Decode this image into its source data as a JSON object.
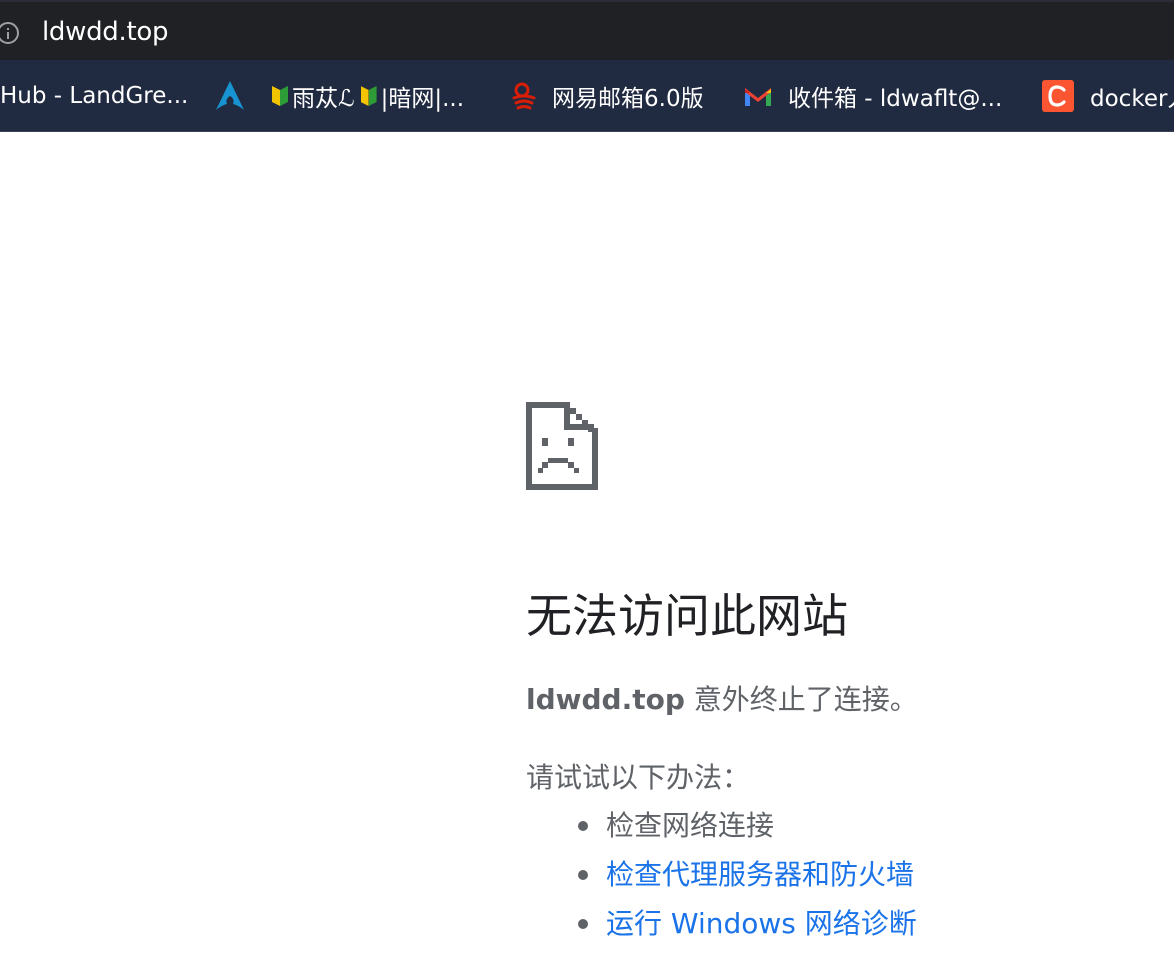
{
  "address_bar": {
    "url": "ldwdd.top",
    "icon": "info-icon"
  },
  "bookmarks": [
    {
      "label": "Hub - LandGre...",
      "icon": ""
    },
    {
      "label": "",
      "icon": "arch-linux-icon",
      "color": "#1793d1"
    },
    {
      "label": "雨苁ℒ",
      "icon": "beginner-badge-icon"
    },
    {
      "label": "|暗网|...",
      "icon": "beginner-badge-icon"
    },
    {
      "label": "网易邮箱6.0版",
      "icon": "netease-mail-icon",
      "color": "#d81e06"
    },
    {
      "label": "收件箱 - ldwaflt@...",
      "icon": "gmail-icon"
    },
    {
      "label": "docker入",
      "icon": "csdn-icon",
      "color": "#fc5531"
    }
  ],
  "error": {
    "icon": "sad-page-icon",
    "title": "无法访问此网站",
    "host": "ldwdd.top",
    "message": " 意外终止了连接。",
    "suggestions_title": "请试试以下办法：",
    "suggestions": [
      {
        "text": "检查网络连接",
        "link": false
      },
      {
        "text": "检查代理服务器和防火墙",
        "link": true
      },
      {
        "text": "运行 Windows 网络诊断",
        "link": true
      }
    ]
  },
  "colors": {
    "topbar_bg": "#202124",
    "bookmarks_bg": "#202a40",
    "heading": "#202124",
    "body_text": "#5f6368",
    "link": "#1a73e8"
  }
}
